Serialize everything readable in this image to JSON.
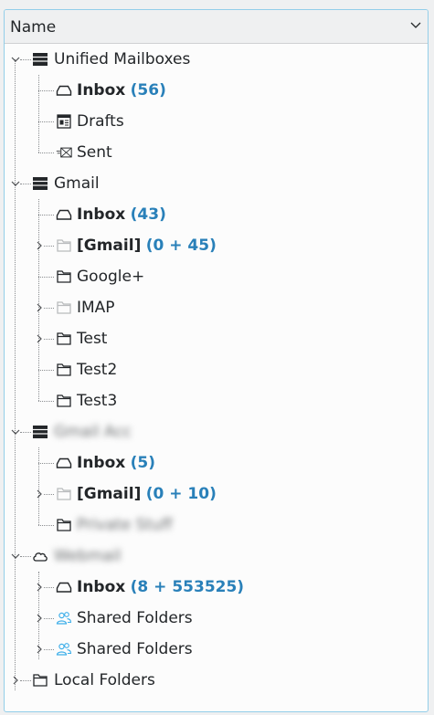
{
  "header": {
    "column_label": "Name"
  },
  "colors": {
    "accent": "#2980b9",
    "focus_border": "#93cee9"
  },
  "tree": {
    "unified": {
      "label": "Unified Mailboxes",
      "inbox": {
        "label": "Inbox",
        "count": "(56)"
      },
      "drafts": {
        "label": "Drafts"
      },
      "sent": {
        "label": "Sent"
      }
    },
    "gmail": {
      "label": "Gmail",
      "inbox": {
        "label": "Inbox",
        "count": "(43)"
      },
      "gmail_folder": {
        "label": "[Gmail]",
        "count": "(0 + 45)"
      },
      "google_plus": {
        "label": "Google+"
      },
      "imap": {
        "label": "IMAP"
      },
      "test": {
        "label": "Test"
      },
      "test2": {
        "label": "Test2"
      },
      "test3": {
        "label": "Test3"
      }
    },
    "account3": {
      "label": "Gmail Acc",
      "inbox": {
        "label": "Inbox",
        "count": "(5)"
      },
      "gmail_folder": {
        "label": "[Gmail]",
        "count": "(0 + 10)"
      },
      "folder": {
        "label": "Private Stuff"
      }
    },
    "account4": {
      "label": "Webmail",
      "inbox": {
        "label": "Inbox",
        "count": "(8 + 553525)"
      },
      "shared1": {
        "label": "Shared Folders"
      },
      "shared2": {
        "label": "Shared Folders"
      }
    },
    "local": {
      "label": "Local Folders"
    }
  }
}
